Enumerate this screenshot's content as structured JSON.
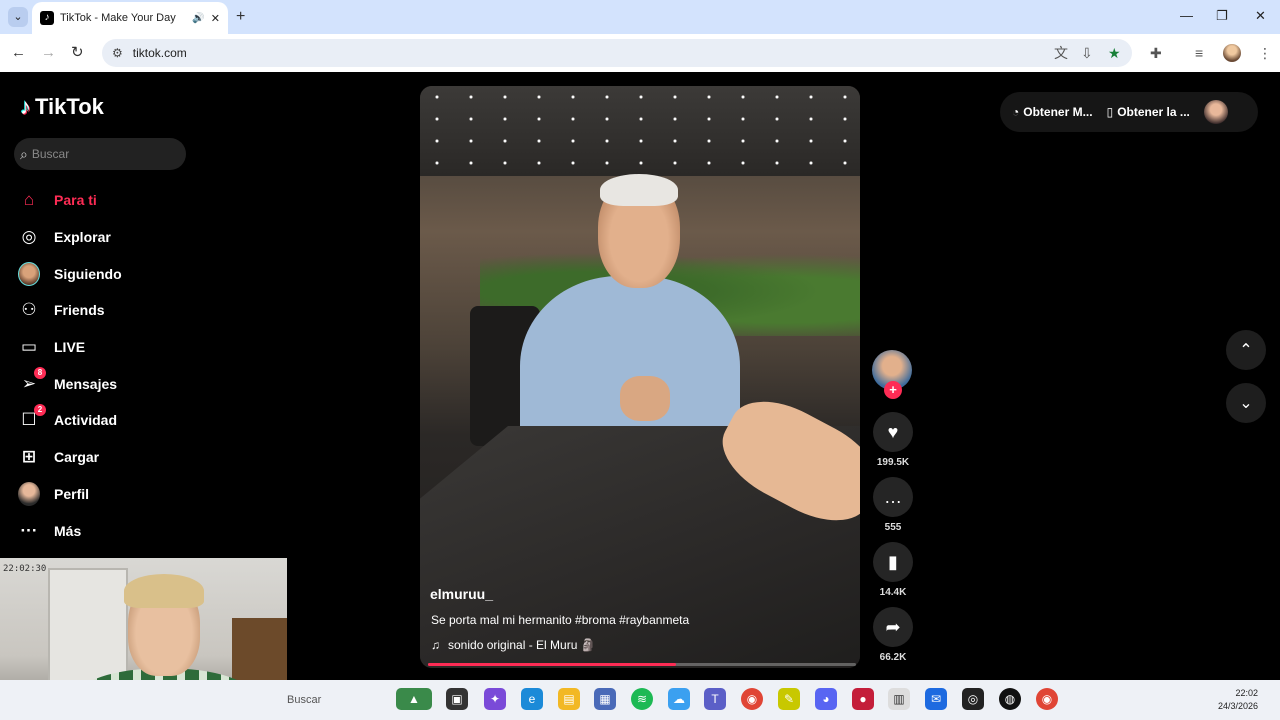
{
  "browser": {
    "tab_title": "TikTok - Make Your Day",
    "url": "tiktok.com",
    "new_tab": "+",
    "tab_close": "✕"
  },
  "sidebar": {
    "logo": "TikTok",
    "search_placeholder": "Buscar",
    "items": [
      {
        "label": "Para ti",
        "icon": "home-icon",
        "active": true
      },
      {
        "label": "Explorar",
        "icon": "compass-icon"
      },
      {
        "label": "Siguiendo",
        "icon": "avatar"
      },
      {
        "label": "Friends",
        "icon": "friends-icon"
      },
      {
        "label": "LIVE",
        "icon": "live-tv-icon"
      },
      {
        "label": "Mensajes",
        "icon": "messages-icon",
        "badge": "8"
      },
      {
        "label": "Actividad",
        "icon": "activity-icon",
        "badge": "2"
      },
      {
        "label": "Cargar",
        "icon": "upload-icon"
      },
      {
        "label": "Perfil",
        "icon": "avatar"
      },
      {
        "label": "Más",
        "icon": "more-icon"
      }
    ]
  },
  "webcam": {
    "timestamp": "22:02:30"
  },
  "video": {
    "author": "elmuruu_",
    "caption": "Se porta mal mi hermanito #broma #raybanmeta",
    "music": "sonido original - El Muru 🗿",
    "progress": 0.58
  },
  "actions": {
    "likes": "199.5K",
    "comments": "555",
    "saves": "14.4K",
    "shares": "66.2K"
  },
  "top_right": {
    "get_coins": "Obtener M...",
    "get_app": "Obtener la ..."
  },
  "taskbar": {
    "search": "Buscar",
    "time": "22:02",
    "date": "24/3/2026"
  },
  "colors": {
    "accent": "#fe2c55",
    "background": "#000000"
  }
}
